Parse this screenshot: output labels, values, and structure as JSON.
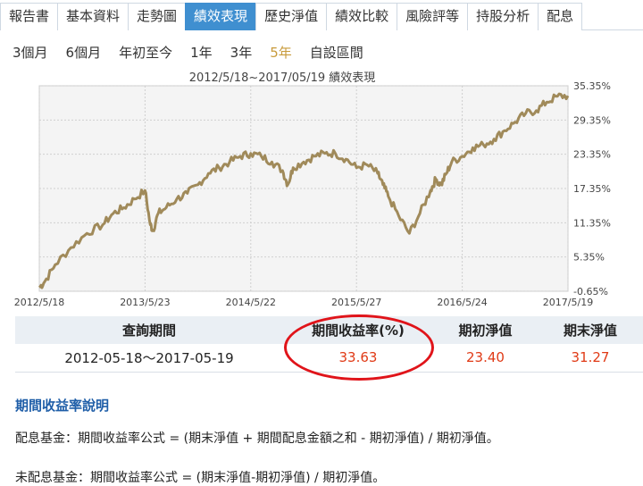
{
  "tabs": [
    {
      "label": "報告書",
      "active": false
    },
    {
      "label": "基本資料",
      "active": false
    },
    {
      "label": "走勢圖",
      "active": false
    },
    {
      "label": "績效表現",
      "active": true
    },
    {
      "label": "歷史淨值",
      "active": false
    },
    {
      "label": "績效比較",
      "active": false
    },
    {
      "label": "風險評等",
      "active": false
    },
    {
      "label": "持股分析",
      "active": false
    },
    {
      "label": "配息",
      "active": false
    }
  ],
  "periods": [
    {
      "label": "3個月",
      "selected": false
    },
    {
      "label": "6個月",
      "selected": false
    },
    {
      "label": "年初至今",
      "selected": false
    },
    {
      "label": "1年",
      "selected": false
    },
    {
      "label": "3年",
      "selected": false
    },
    {
      "label": "5年",
      "selected": true
    },
    {
      "label": "自設區間",
      "selected": false
    }
  ],
  "chart_data": {
    "type": "line",
    "title": "2012/5/18~2017/05/19 績效表現",
    "x_ticks": [
      "2012/5/18",
      "2013/5/23",
      "2014/5/22",
      "2015/5/27",
      "2016/5/24",
      "2017/5/19"
    ],
    "y_ticks": [
      "-0.65%",
      "5.35%",
      "11.35%",
      "17.35%",
      "23.35%",
      "29.35%",
      "35.35%"
    ],
    "ylim": [
      -0.65,
      35.35
    ],
    "series": [
      {
        "color": "#a08a5a",
        "x": [
          0,
          0.01,
          0.03,
          0.06,
          0.09,
          0.12,
          0.14,
          0.16,
          0.18,
          0.2,
          0.21,
          0.215,
          0.225,
          0.24,
          0.26,
          0.28,
          0.3,
          0.32,
          0.34,
          0.36,
          0.38,
          0.4,
          0.42,
          0.44,
          0.46,
          0.47,
          0.48,
          0.5,
          0.52,
          0.54,
          0.56,
          0.58,
          0.6,
          0.62,
          0.64,
          0.65,
          0.66,
          0.68,
          0.7,
          0.72,
          0.74,
          0.75,
          0.76,
          0.77,
          0.78,
          0.8,
          0.82,
          0.84,
          0.86,
          0.88,
          0.9,
          0.92,
          0.94,
          0.96,
          0.98,
          1.0
        ],
        "y": [
          0,
          1,
          4,
          7,
          9.5,
          11,
          13,
          14,
          15.5,
          17,
          11,
          10,
          13,
          14,
          15.5,
          16.5,
          18,
          20,
          21,
          22,
          23,
          23.5,
          23,
          22,
          20.5,
          18,
          21,
          22,
          23,
          23.5,
          23.5,
          22.5,
          21,
          21.5,
          20,
          18,
          16,
          12.5,
          9.5,
          13,
          17,
          19,
          18,
          20,
          22,
          23,
          24.5,
          25,
          26,
          27.5,
          29,
          30.5,
          31,
          32.5,
          33.5,
          33.6
        ]
      }
    ]
  },
  "table": {
    "headers": [
      "查詢期間",
      "期間收益率(%)",
      "期初淨值",
      "期末淨值"
    ],
    "row": {
      "period": "2012-05-18～2017-05-19",
      "return": "33.63",
      "start_nav": "23.40",
      "end_nav": "31.27"
    }
  },
  "explanation": {
    "title": "期間收益率說明",
    "line1": "配息基金：期間收益率公式 = (期末淨值 + 期間配息金額之和 - 期初淨值) / 期初淨值。",
    "line2": "未配息基金：期間收益率公式 = (期末淨值-期初淨值) / 期初淨值。"
  },
  "colors": {
    "tab_active_bg": "#3f8fd0",
    "selected_period": "#c89b3c",
    "value_red": "#e03a16",
    "highlight_oval": "#e0141a",
    "section_title": "#1f5ea8",
    "line": "#a08a5a"
  }
}
